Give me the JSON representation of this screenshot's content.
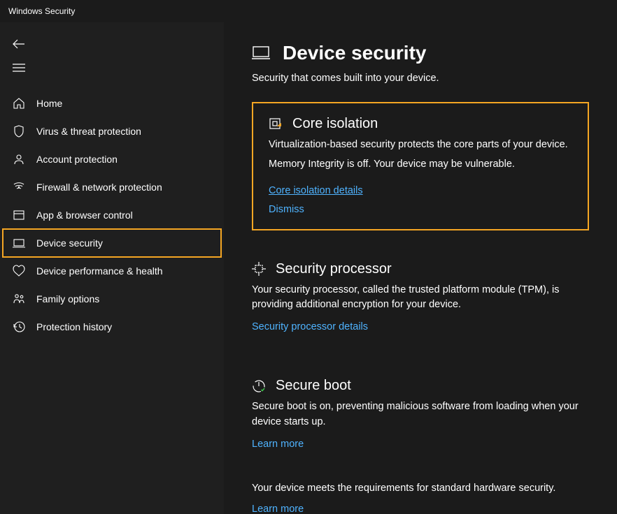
{
  "titlebar": {
    "title": "Windows Security"
  },
  "sidebar": {
    "items": [
      {
        "label": "Home",
        "icon": "home-icon"
      },
      {
        "label": "Virus & threat protection",
        "icon": "shield-icon"
      },
      {
        "label": "Account protection",
        "icon": "account-icon"
      },
      {
        "label": "Firewall & network protection",
        "icon": "network-icon"
      },
      {
        "label": "App & browser control",
        "icon": "app-icon"
      },
      {
        "label": "Device security",
        "icon": "device-icon",
        "selected": true
      },
      {
        "label": "Device performance & health",
        "icon": "health-icon"
      },
      {
        "label": "Family options",
        "icon": "family-icon"
      },
      {
        "label": "Protection history",
        "icon": "history-icon"
      }
    ]
  },
  "page": {
    "title": "Device security",
    "subtitle": "Security that comes built into your device."
  },
  "sections": {
    "core_isolation": {
      "title": "Core isolation",
      "description": "Virtualization-based security protects the core parts of your device.",
      "status": "Memory Integrity is off. Your device may be vulnerable.",
      "details_link": "Core isolation details",
      "dismiss_label": "Dismiss"
    },
    "security_processor": {
      "title": "Security processor",
      "description": "Your security processor, called the trusted platform module (TPM), is providing additional encryption for your device.",
      "details_link": "Security processor details"
    },
    "secure_boot": {
      "title": "Secure boot",
      "description": "Secure boot is on, preventing malicious software from loading when your device starts up.",
      "learn_more": "Learn more"
    },
    "footer": {
      "description": "Your device meets the requirements for standard hardware security.",
      "learn_more": "Learn more"
    }
  }
}
